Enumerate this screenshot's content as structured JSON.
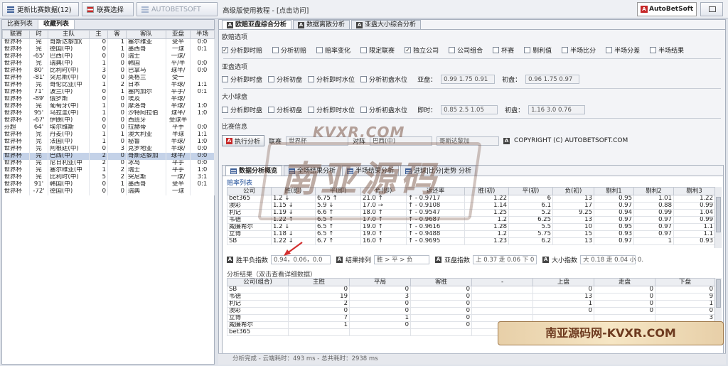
{
  "toolbar": {
    "refresh_label": "更新比赛数据(12)",
    "league_select_label": "联赛选择",
    "autobet_label": "AUTOBETSOFT",
    "tutorial_text": "高级版使用教程 - [点击访问]",
    "logo_text": "AutoBetSoft"
  },
  "left_panel": {
    "tabs": [
      "比赛列表",
      "收藏列表"
    ],
    "columns": [
      "联赛",
      "时",
      "主队",
      "主",
      "客",
      "客队",
      "亚盘",
      "半场"
    ],
    "rows": [
      [
        "世界杯",
        "完",
        "哥斯达黎加(",
        "0",
        "1",
        "塞尔维亚",
        "受半",
        "0:0"
      ],
      [
        "世界杯",
        "完",
        "德国(中)",
        "0",
        "1",
        "墨西哥",
        "一球",
        "0:1"
      ],
      [
        "世界杯",
        "-65'",
        "巴西(中)",
        "0",
        "0",
        "瑞士",
        "一球/",
        ""
      ],
      [
        "世界杯",
        "完",
        "瑞典(中)",
        "1",
        "0",
        "韩国",
        "平/半",
        "0:0"
      ],
      [
        "世界杯",
        "80'",
        "比利时(中)",
        "3",
        "0",
        "巴拿马",
        "球半/",
        "0:0"
      ],
      [
        "世界杯",
        "-81'",
        "突尼斯(中)",
        "0",
        "0",
        "英格兰",
        "受一",
        ""
      ],
      [
        "世界杯",
        "完",
        "哥伦比亚(中",
        "1",
        "2",
        "日本",
        "半球/",
        "1:1"
      ],
      [
        "世界杯",
        "71'",
        "波兰(中)",
        "0",
        "1",
        "塞内加尔",
        "平手/",
        "0:1"
      ],
      [
        "世界杯",
        "-89'",
        "俄罗斯",
        "0",
        "0",
        "埃及",
        "半球/",
        ""
      ],
      [
        "世界杯",
        "完",
        "葡萄牙(中)",
        "1",
        "0",
        "摩洛哥",
        "半球/",
        "1:0"
      ],
      [
        "世界杯",
        "95'",
        "乌拉圭(中)",
        "1",
        "0",
        "沙特阿拉伯",
        "球半/",
        "1:0"
      ],
      [
        "世界杯",
        "-67'",
        "伊朗(中)",
        "0",
        "0",
        "西班牙",
        "受球半",
        ""
      ],
      [
        "芬超",
        "64'",
        "埃尔维斯",
        "0",
        "0",
        "拉赫蒂",
        "平手",
        "0:0"
      ],
      [
        "世界杯",
        "完",
        "丹麦(中)",
        "1",
        "1",
        "澳大利亚",
        "半球",
        "1:1"
      ],
      [
        "世界杯",
        "完",
        "法国(中)",
        "1",
        "0",
        "秘鲁",
        "半球/",
        "1:0"
      ],
      [
        "世界杯",
        "完",
        "阿根廷(中)",
        "0",
        "3",
        "克罗地亚",
        "半球/",
        "0:0"
      ],
      [
        "世界杯",
        "完",
        "巴西(中)",
        "2",
        "0",
        "哥斯达黎加",
        "球半/",
        "0:0"
      ],
      [
        "世界杯",
        "完",
        "尼日利亚(中",
        "2",
        "0",
        "冰岛",
        "平手",
        "0:0"
      ],
      [
        "世界杯",
        "完",
        "塞尔维亚(中",
        "1",
        "2",
        "瑞士",
        "平手",
        "1:0"
      ],
      [
        "世界杯",
        "完",
        "比利时(中)",
        "5",
        "2",
        "突尼斯",
        "一球/",
        "3:1"
      ],
      [
        "世界杯",
        "91'",
        "韩国(中)",
        "0",
        "1",
        "墨西哥",
        "受半",
        "0:1"
      ],
      [
        "世界杯",
        "-72'",
        "德国(中)",
        "0",
        "0",
        "瑞典",
        "一球",
        ""
      ]
    ],
    "selected_row": 16
  },
  "right_tabs": [
    "欧赔亚盘综合分析",
    "数据离散分析",
    "亚盘大小综合分析"
  ],
  "euro_section": {
    "title": "欧赔选项",
    "options": [
      {
        "label": "分析即时赔",
        "checked": true
      },
      {
        "label": "分析初赔",
        "checked": false
      },
      {
        "label": "赔率变化",
        "checked": false
      },
      {
        "label": "限定联赛",
        "checked": false
      },
      {
        "label": "独立公司",
        "checked": true
      },
      {
        "label": "公司组合",
        "checked": false
      },
      {
        "label": "杯赛",
        "checked": false
      },
      {
        "label": "剔利值",
        "checked": false
      },
      {
        "label": "半场比分",
        "checked": false
      },
      {
        "label": "半场分差",
        "checked": false
      },
      {
        "label": "半场结果",
        "checked": false
      }
    ]
  },
  "asian_section": {
    "title": "亚盘选项",
    "options": [
      "分析即时盘",
      "分析初盘",
      "分析即时水位",
      "分析初盘水位"
    ],
    "live_label": "亚盘：",
    "live_value": "0.99 1.75 0.91",
    "init_label": "初盘：",
    "init_value": "0.96 1.75 0.97"
  },
  "ou_section": {
    "title": "大小球盘",
    "options": [
      "分析即时盘",
      "分析初盘",
      "分析即时水位",
      "分析初盘水位"
    ],
    "live_label": "即时：",
    "live_value": "0.85 2.5 1.05",
    "init_label": "初盘：",
    "init_value": "1.16 3.0 0.76"
  },
  "match_info": {
    "title": "比赛信息",
    "exec_label": "执行分析",
    "league_label": "联赛",
    "league_value": "世界杯",
    "vs_label": "对阵",
    "home_value": "巴西(中)",
    "away_value": "哥斯达黎加",
    "copyright": "COPYRIGHT (C) AUTOBETSOFT.COM"
  },
  "inner_tabs": [
    "数据分析概览",
    "全场结果分析",
    "半场结果分析",
    "进球|比分|走势 分析"
  ],
  "odds": {
    "title": "赔率列表",
    "columns": [
      "公司",
      "胜(即)",
      "平(即)",
      "负(即)",
      "返还率",
      "胜(初)",
      "平(初)",
      "负(初)",
      "剔利1",
      "剔利2",
      "剔利3"
    ],
    "rows": [
      [
        "bet365",
        "1.2 ↓",
        "6.75 ↑",
        "21.0 ↑",
        "↑ - 0.9717",
        "1.22",
        "6",
        "13",
        "0.95",
        "1.01",
        "1.22"
      ],
      [
        "澳彩",
        "1.15 ↓",
        "5.9 ↓",
        "17.0 →",
        "↑ - 0.9108",
        "1.14",
        "6.1",
        "17",
        "0.97",
        "0.88",
        "0.99"
      ],
      [
        "利记",
        "1.19 ↓",
        "6.6 ↑",
        "18.0 ↑",
        "↑ - 0.9547",
        "1.25",
        "5.2",
        "9.25",
        "0.94",
        "0.99",
        "1.04"
      ],
      [
        "韦德",
        "1.22 ↑",
        "6.5 ↑",
        "17.0 ↑",
        "↑ - 0.9687",
        "1.2",
        "6.25",
        "13",
        "0.97",
        "0.97",
        "0.99"
      ],
      [
        "威廉希尔",
        "1.2 ↓",
        "6.5 ↑",
        "19.0 ↑",
        "↑ - 0.9616",
        "1.28",
        "5.5",
        "10",
        "0.95",
        "0.97",
        "1.1"
      ],
      [
        "立博",
        "1.18 ↓",
        "6.5 ↑",
        "19.0 ↑",
        "↑ - 0.9488",
        "1.2",
        "5.75",
        "15",
        "0.93",
        "0.97",
        "1.1"
      ],
      [
        "SB",
        "1.22 ↓",
        "6.7 ↑",
        "16.0 ↑",
        "↑ - 0.9695",
        "1.23",
        "6.2",
        "13",
        "0.97",
        "1",
        "0.93"
      ]
    ]
  },
  "indices": {
    "wdl_label": "胜平负指数",
    "wdl_value": "0.94，0.06，0.0",
    "result_label": "结果排列",
    "result_value": "胜 > 平 > 负",
    "asian_label": "亚盘指数",
    "asian_value": "上 0.37 走 0.06 下 0",
    "ou_label": "大小指数",
    "ou_value": "大 0.18 走 0.04 小 0."
  },
  "results": {
    "title": "分析结果（双击查看详细数据）",
    "columns": [
      "公司(组合)",
      "主胜",
      "平局",
      "客胜",
      "-",
      "上盘",
      "走盘",
      "下盘"
    ],
    "rows": [
      [
        "SB",
        "0",
        "0",
        "0",
        "",
        "0",
        "0",
        "0"
      ],
      [
        "韦德",
        "19",
        "3",
        "0",
        "",
        "13",
        "0",
        "9"
      ],
      [
        "利记",
        "2",
        "0",
        "0",
        "",
        "1",
        "0",
        "1"
      ],
      [
        "澳彩",
        "0",
        "0",
        "0",
        "",
        "0",
        "0",
        "0"
      ],
      [
        "立博",
        "7",
        "1",
        "0",
        "",
        "",
        "",
        "3"
      ],
      [
        "威廉希尔",
        "1",
        "0",
        "0",
        "",
        "",
        "",
        "0"
      ],
      [
        "bet365",
        "",
        "",
        "",
        "",
        "",
        "",
        ""
      ]
    ]
  },
  "status": "分析完成 - 云端耗时：493 ms - 总共耗时：2938 ms",
  "watermarks": {
    "top": "KVXR.COM",
    "center": "南亚源码",
    "bottom": "南亚源码网-KVXR.COM"
  },
  "colors": {
    "accent": "#c62828",
    "selection": "#c4d2e8",
    "watermark": "#7d5a4a"
  }
}
